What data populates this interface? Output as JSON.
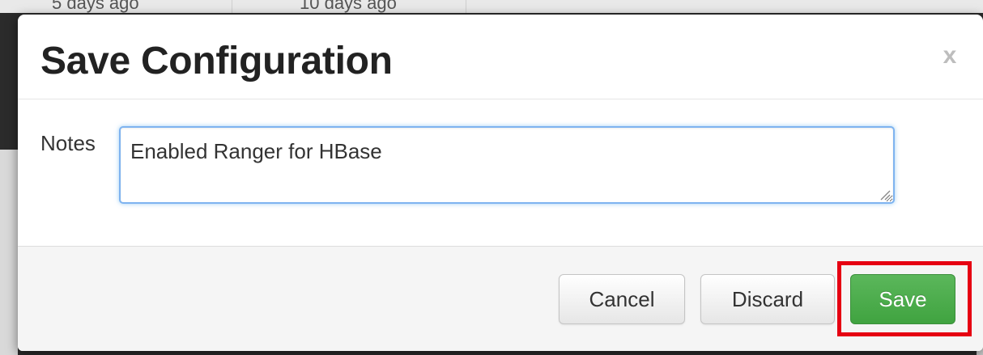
{
  "background": {
    "text_1": "5 days ago",
    "text_2": "10 days ago"
  },
  "modal": {
    "title": "Save Configuration",
    "close_label": "x",
    "notes": {
      "label": "Notes",
      "value": "Enabled Ranger for HBase"
    },
    "footer": {
      "cancel_label": "Cancel",
      "discard_label": "Discard",
      "save_label": "Save"
    }
  },
  "colors": {
    "save_button": "#49a949",
    "highlight": "#e60012",
    "focus_border": "#7eb3f0"
  }
}
